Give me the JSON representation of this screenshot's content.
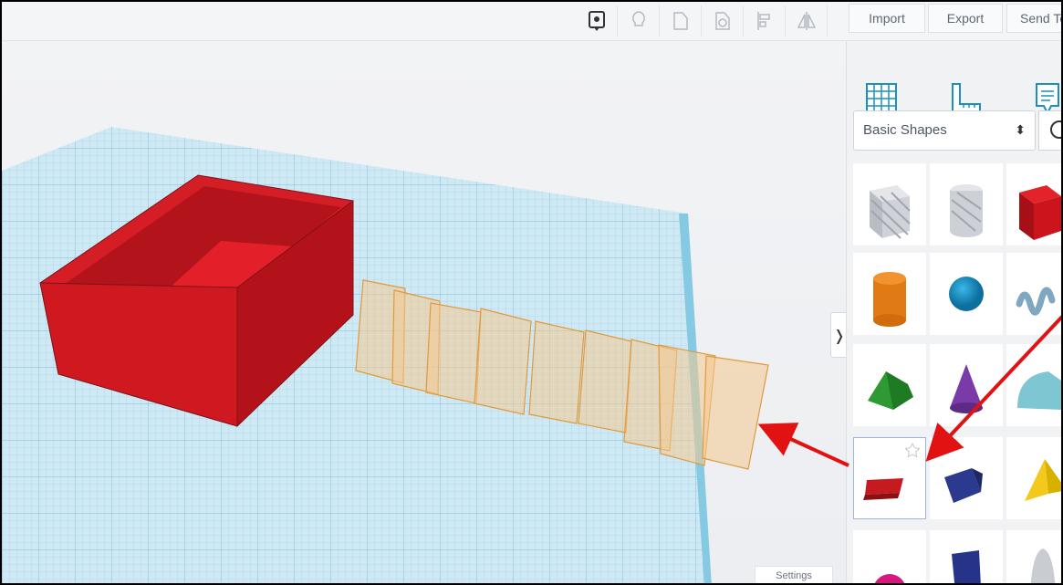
{
  "toolbar": {
    "tools": [
      {
        "icon": "note-pin-icon"
      },
      {
        "icon": "lightbulb-icon"
      },
      {
        "icon": "shape-outline-icon"
      },
      {
        "icon": "shape-hole-icon"
      },
      {
        "icon": "align-icon"
      },
      {
        "icon": "mirror-icon"
      }
    ],
    "buttons": {
      "import": "Import",
      "export": "Export",
      "send_to": "Send To"
    }
  },
  "views": {
    "grid": "workplane-icon",
    "ruler": "ruler-icon",
    "notes": "notes-icon"
  },
  "shapes_panel": {
    "category": "Basic Shapes",
    "search_icon": "search-icon",
    "shapes": [
      {
        "name": "box-hole",
        "icon": "striped-box-icon"
      },
      {
        "name": "cylinder-hole",
        "icon": "striped-cylinder-icon"
      },
      {
        "name": "box",
        "icon": "red-box-icon"
      },
      {
        "name": "cylinder",
        "icon": "orange-cylinder-icon"
      },
      {
        "name": "sphere",
        "icon": "blue-sphere-icon"
      },
      {
        "name": "scribble",
        "icon": "scribble-icon"
      },
      {
        "name": "roof",
        "icon": "green-roof-icon"
      },
      {
        "name": "cone",
        "icon": "purple-cone-icon"
      },
      {
        "name": "round-roof",
        "icon": "teal-roundroof-icon"
      },
      {
        "name": "text",
        "icon": "red-text-icon"
      },
      {
        "name": "wedge",
        "icon": "navy-wedge-icon"
      },
      {
        "name": "pyramid",
        "icon": "yellow-pyramid-icon"
      },
      {
        "name": "half-sphere",
        "icon": "magenta-halfsphere-icon"
      },
      {
        "name": "polygon",
        "icon": "navy-polygon-icon"
      },
      {
        "name": "paraboloid",
        "icon": "grey-paraboloid-icon"
      }
    ],
    "selected": "text"
  },
  "viewport": {
    "settings": "Settings",
    "colors": {
      "grid": "#a8d6e8",
      "box": "#c8161e",
      "text_ghost": "#f4b45a"
    }
  },
  "annotations": {
    "arrow_color": "#e11212"
  }
}
